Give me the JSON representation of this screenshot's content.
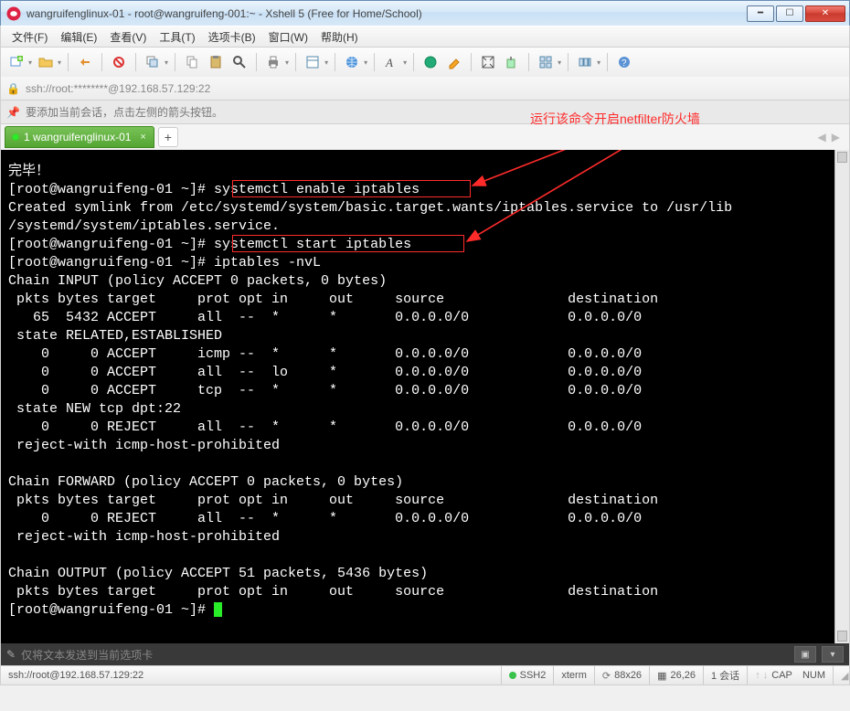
{
  "title": "wangruifenglinux-01 - root@wangruifeng-001:~ - Xshell 5 (Free for Home/School)",
  "menus": [
    "文件(F)",
    "编辑(E)",
    "查看(V)",
    "工具(T)",
    "选项卡(B)",
    "窗口(W)",
    "帮助(H)"
  ],
  "address": "ssh://root:********@192.168.57.129:22",
  "hint": "要添加当前会话，点击左侧的箭头按钮。",
  "annotation": "运行该命令开启netfilter防火墙",
  "tab": {
    "label": "1 wangruifenglinux-01"
  },
  "terminal": {
    "lines": [
      "完毕！",
      "[root@wangruifeng-01 ~]# systemctl enable iptables",
      "Created symlink from /etc/systemd/system/basic.target.wants/iptables.service to /usr/lib",
      "/systemd/system/iptables.service.",
      "[root@wangruifeng-01 ~]# systemctl start iptables",
      "[root@wangruifeng-01 ~]# iptables -nvL",
      "Chain INPUT (policy ACCEPT 0 packets, 0 bytes)",
      " pkts bytes target     prot opt in     out     source               destination",
      "   65  5432 ACCEPT     all  --  *      *       0.0.0.0/0            0.0.0.0/0",
      " state RELATED,ESTABLISHED",
      "    0     0 ACCEPT     icmp --  *      *       0.0.0.0/0            0.0.0.0/0",
      "    0     0 ACCEPT     all  --  lo     *       0.0.0.0/0            0.0.0.0/0",
      "    0     0 ACCEPT     tcp  --  *      *       0.0.0.0/0            0.0.0.0/0",
      " state NEW tcp dpt:22",
      "    0     0 REJECT     all  --  *      *       0.0.0.0/0            0.0.0.0/0",
      " reject-with icmp-host-prohibited",
      "",
      "Chain FORWARD (policy ACCEPT 0 packets, 0 bytes)",
      " pkts bytes target     prot opt in     out     source               destination",
      "    0     0 REJECT     all  --  *      *       0.0.0.0/0            0.0.0.0/0",
      " reject-with icmp-host-prohibited",
      "",
      "Chain OUTPUT (policy ACCEPT 51 packets, 5436 bytes)",
      " pkts bytes target     prot opt in     out     source               destination",
      "[root@wangruifeng-01 ~]# "
    ],
    "highlight_boxes": [
      {
        "line": 1,
        "text": "systemctl enable iptables"
      },
      {
        "line": 4,
        "text": "systemctl start iptables"
      }
    ]
  },
  "sendbar": "仅将文本发送到当前选项卡",
  "status": {
    "conn": "ssh://root@192.168.57.129:22",
    "ssh": "SSH2",
    "term": "xterm",
    "size": "88x26",
    "pos": "26,26",
    "sessions": "1 会话",
    "cap": "CAP",
    "num": "NUM"
  },
  "toolbar_icons": [
    "new-session-icon",
    "open-icon",
    "sep",
    "reconnect-icon",
    "sep",
    "disconnect-icon",
    "sep",
    "copy-session-icon",
    "sep",
    "copy-icon",
    "paste-icon",
    "find-icon",
    "sep",
    "print-icon",
    "sep",
    "properties-icon",
    "sep",
    "globe-icon",
    "sep",
    "font-icon",
    "sep",
    "color-scheme-icon",
    "highlight-icon",
    "sep",
    "fullscreen-icon",
    "transparency-icon",
    "sep",
    "tile-icon",
    "sep",
    "cascade-icon",
    "sep",
    "help-icon"
  ]
}
